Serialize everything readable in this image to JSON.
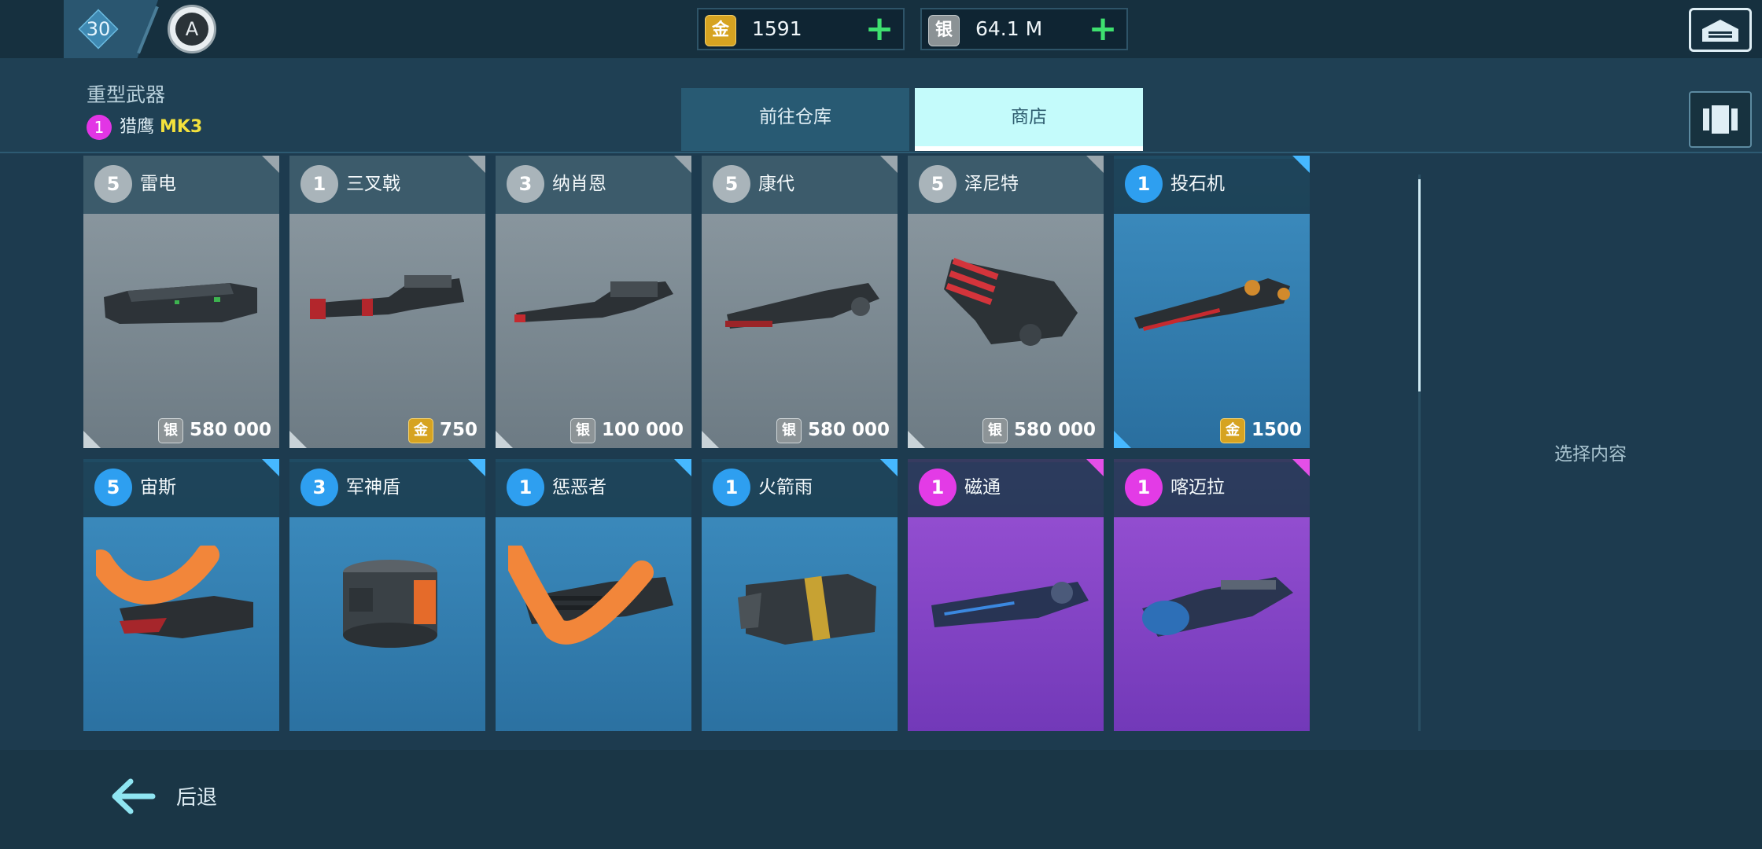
{
  "topbar": {
    "level": "30",
    "emblem_glyph": "A",
    "gold": {
      "icon": "金",
      "value": "1591",
      "plus": "+"
    },
    "silver": {
      "icon": "银",
      "value": "64.1 M",
      "plus": "+"
    },
    "garage_icon": "garage-icon"
  },
  "header": {
    "category": "重型武器",
    "selected_weapon": {
      "tier": "1",
      "name": "猎鹰",
      "suffix": "MK3"
    },
    "tabs": [
      {
        "label": "前往仓库"
      },
      {
        "label": "商店"
      }
    ]
  },
  "cards": [
    {
      "tier": "5",
      "name": "雷电",
      "rarity": "grey",
      "price_icon": "银",
      "price": "580 000"
    },
    {
      "tier": "1",
      "name": "三叉戟",
      "rarity": "grey",
      "price_icon": "金",
      "price": "750"
    },
    {
      "tier": "3",
      "name": "纳肖恩",
      "rarity": "grey",
      "price_icon": "银",
      "price": "100 000"
    },
    {
      "tier": "5",
      "name": "康代",
      "rarity": "grey",
      "price_icon": "银",
      "price": "580 000"
    },
    {
      "tier": "5",
      "name": "泽尼特",
      "rarity": "grey",
      "price_icon": "银",
      "price": "580 000"
    },
    {
      "tier": "1",
      "name": "投石机",
      "rarity": "blue",
      "price_icon": "金",
      "price": "1500"
    },
    {
      "tier": "5",
      "name": "宙斯",
      "rarity": "blue"
    },
    {
      "tier": "3",
      "name": "军神盾",
      "rarity": "blue"
    },
    {
      "tier": "1",
      "name": "惩恶者",
      "rarity": "blue"
    },
    {
      "tier": "1",
      "name": "火箭雨",
      "rarity": "blue"
    },
    {
      "tier": "1",
      "name": "磁通",
      "rarity": "purple"
    },
    {
      "tier": "1",
      "name": "喀迈拉",
      "rarity": "purple"
    }
  ],
  "detail": {
    "hint": "选择内容"
  },
  "footer": {
    "back_label": "后退"
  },
  "colors": {
    "accent": "#c4fbfb",
    "gold": "#d6a321",
    "plus": "#3ee06f",
    "legendary": "#e33be6",
    "rare": "#2e9ff0"
  }
}
